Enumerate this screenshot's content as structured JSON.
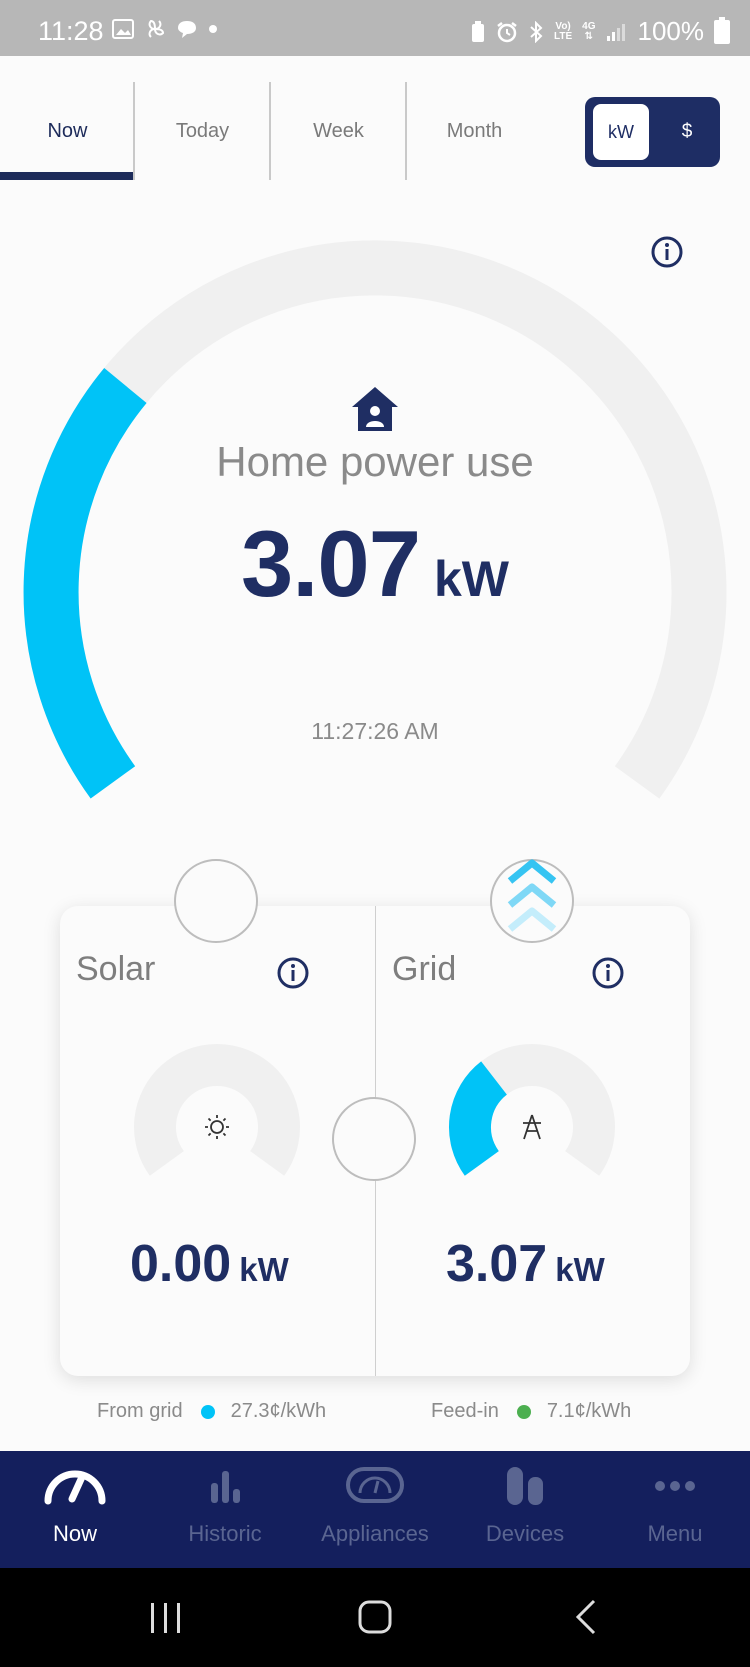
{
  "status_bar": {
    "time": "11:28",
    "network_top": "Vo)",
    "network_bottom": "LTE",
    "signal_label": "4G",
    "battery": "100%"
  },
  "tabs": [
    {
      "label": "Now",
      "active": true
    },
    {
      "label": "Today",
      "active": false
    },
    {
      "label": "Week",
      "active": false
    },
    {
      "label": "Month",
      "active": false
    }
  ],
  "unit_toggle": {
    "kw_label": "kW",
    "dollar_label": "$",
    "selected": "kW"
  },
  "home": {
    "title": "Home power use",
    "value": "3.07",
    "unit": "kW",
    "timestamp": "11:27:26 AM",
    "gauge_fraction": 0.3
  },
  "solar": {
    "title": "Solar",
    "value": "0.00",
    "unit": "kW",
    "gauge_fraction": 0.0
  },
  "grid": {
    "title": "Grid",
    "value": "3.07",
    "unit": "kW",
    "gauge_fraction": 0.35
  },
  "rates": {
    "from_grid_label": "From grid",
    "from_grid_value": "27.3¢/kWh",
    "feed_in_label": "Feed-in",
    "feed_in_value": "7.1¢/kWh"
  },
  "bottom_nav": [
    {
      "label": "Now",
      "icon": "speedometer-icon",
      "active": true
    },
    {
      "label": "Historic",
      "icon": "bar-chart-icon",
      "active": false
    },
    {
      "label": "Appliances",
      "icon": "appliance-icon",
      "active": false
    },
    {
      "label": "Devices",
      "icon": "devices-icon",
      "active": false
    },
    {
      "label": "Menu",
      "icon": "more-icon",
      "active": false
    }
  ],
  "colors": {
    "navy": "#1f2e63",
    "accent_blue": "#00c3f7",
    "gauge_track": "#f0f0f0",
    "feed_in_green": "#4caf50",
    "nav_bg": "#141f5d"
  }
}
